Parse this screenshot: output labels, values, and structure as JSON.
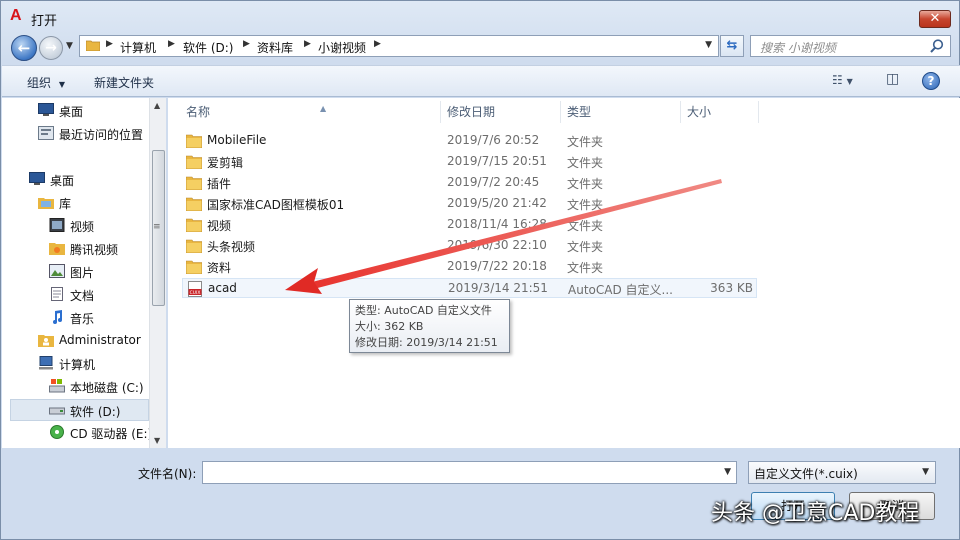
{
  "window": {
    "title": "打开",
    "app_icon": "A"
  },
  "address": {
    "crumbs": [
      "计算机",
      "软件 (D:)",
      "资料库",
      "小谢视频"
    ],
    "search_placeholder": "搜索 小谢视频"
  },
  "toolbar": {
    "organize": "组织",
    "new_folder": "新建文件夹"
  },
  "nav": {
    "items": [
      {
        "label": "桌面",
        "icon": "desktop-icon"
      },
      {
        "label": "最近访问的位置",
        "icon": "recent-places-icon"
      },
      {
        "label": "桌面",
        "icon": "desktop-icon"
      },
      {
        "label": "库",
        "icon": "library-icon"
      },
      {
        "label": "视频",
        "icon": "video-library-icon"
      },
      {
        "label": "腾讯视频",
        "icon": "tencent-video-icon"
      },
      {
        "label": "图片",
        "icon": "pictures-icon"
      },
      {
        "label": "文档",
        "icon": "documents-icon"
      },
      {
        "label": "音乐",
        "icon": "music-icon"
      },
      {
        "label": "Administrator",
        "icon": "user-folder-icon"
      },
      {
        "label": "计算机",
        "icon": "computer-icon"
      },
      {
        "label": "本地磁盘 (C:)",
        "icon": "local-disk-icon"
      },
      {
        "label": "软件 (D:)",
        "icon": "drive-icon"
      },
      {
        "label": "CD 驱动器 (E:)",
        "icon": "cd-drive-icon"
      }
    ]
  },
  "columns": {
    "name": "名称",
    "date": "修改日期",
    "type": "类型",
    "size": "大小"
  },
  "files": [
    {
      "name": "MobileFile",
      "date": "2019/7/6 20:52",
      "type": "文件夹",
      "size": ""
    },
    {
      "name": "爱剪辑",
      "date": "2019/7/15 20:51",
      "type": "文件夹",
      "size": ""
    },
    {
      "name": "插件",
      "date": "2019/7/2 20:45",
      "type": "文件夹",
      "size": ""
    },
    {
      "name": "国家标准CAD图框模板01",
      "date": "2019/5/20 21:42",
      "type": "文件夹",
      "size": ""
    },
    {
      "name": "视频",
      "date": "2018/11/4 16:28",
      "type": "文件夹",
      "size": ""
    },
    {
      "name": "头条视频",
      "date": "2019/6/30 22:10",
      "type": "文件夹",
      "size": ""
    },
    {
      "name": "资料",
      "date": "2019/7/22 20:18",
      "type": "文件夹",
      "size": ""
    },
    {
      "name": "acad",
      "date": "2019/3/14 21:51",
      "type": "AutoCAD 自定义...",
      "size": "363 KB"
    }
  ],
  "file_icon_label": "CUIX",
  "tooltip": {
    "line1": "类型: AutoCAD 自定义文件",
    "line2": "大小: 362 KB",
    "line3": "修改日期: 2019/3/14 21:51"
  },
  "bottom": {
    "filename_label": "文件名(N):",
    "filename_value": "",
    "filetype_value": "自定义文件(*.cuix)",
    "open_label": "打开",
    "cancel_label": "取消"
  },
  "watermark": "头条 @卫意CAD教程",
  "colors": {
    "accent": "#2d6bc0",
    "arrow": "#e8322d",
    "folder": "#e9b640"
  }
}
